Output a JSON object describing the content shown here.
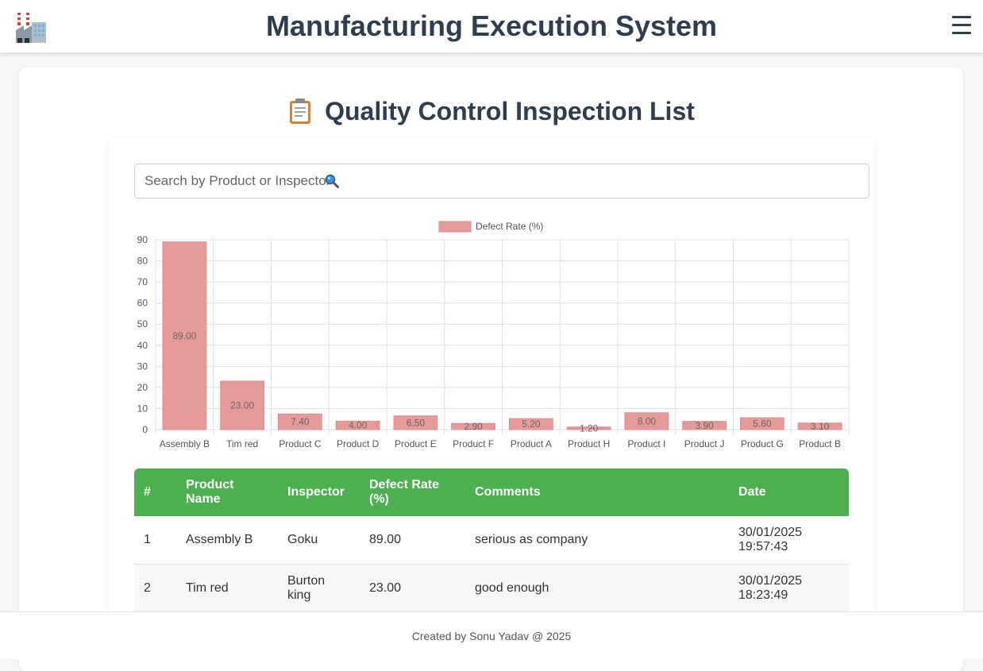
{
  "header": {
    "title": "Manufacturing Execution System",
    "logo_icon": "factory-icon",
    "menu_icon": "hamburger-menu-icon"
  },
  "page": {
    "heading": "Quality Control Inspection List",
    "heading_icon": "clipboard-icon"
  },
  "search": {
    "placeholder": "Search by Product or Inspector",
    "icon": "magnifier-icon"
  },
  "chart_data": {
    "type": "bar",
    "title": "",
    "xlabel": "",
    "ylabel": "",
    "categories": [
      "Assembly B",
      "Tim red",
      "Product C",
      "Product D",
      "Product E",
      "Product F",
      "Product A",
      "Product H",
      "Product I",
      "Product J",
      "Product G",
      "Product B"
    ],
    "series": [
      {
        "name": "Defect Rate (%)",
        "values": [
          89.0,
          23.0,
          7.4,
          4.0,
          6.5,
          2.9,
          5.2,
          1.2,
          8.0,
          3.9,
          5.6,
          3.1
        ],
        "color": "#e79a9a"
      }
    ],
    "value_labels": [
      "89.00",
      "23.00",
      "7.40",
      "4.00",
      "6.50",
      "2.90",
      "5.20",
      "1.20",
      "8.00",
      "3.90",
      "5.60",
      "3.10"
    ],
    "ylim": [
      0,
      90
    ],
    "yticks": [
      0,
      10,
      20,
      30,
      40,
      50,
      60,
      70,
      80,
      90
    ],
    "grid": true,
    "legend_position": "top-center"
  },
  "table": {
    "columns": [
      "#",
      "Product Name",
      "Inspector",
      "Defect Rate (%)",
      "Comments",
      "Date"
    ],
    "rows": [
      {
        "num": "1",
        "product": "Assembly B",
        "inspector": "Goku",
        "defect_rate": "89.00",
        "comments": "serious as company",
        "date": "30/01/2025 19:57:43"
      },
      {
        "num": "2",
        "product": "Tim red",
        "inspector": "Burton king",
        "defect_rate": "23.00",
        "comments": "good enough",
        "date": "30/01/2025 18:23:49"
      }
    ],
    "header_color": "#4caf50"
  },
  "footer": {
    "text": "Created by Sonu Yadav @ 2025"
  }
}
